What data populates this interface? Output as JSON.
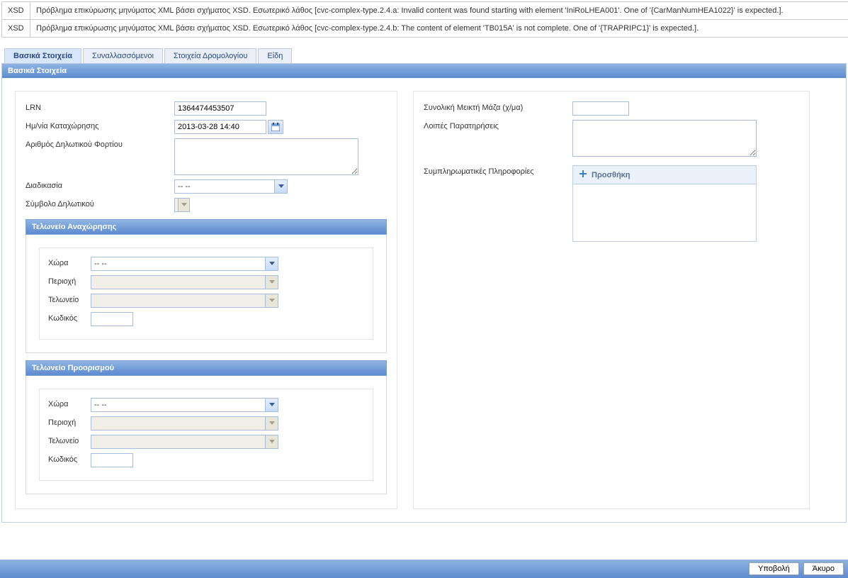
{
  "errors": [
    {
      "code": "XSD",
      "msg": "Πρόβλημα επικύρωσης μηνύματος XML βάσει σχήματος XSD. Εσωτερικό λάθος [cvc-complex-type.2.4.a: Invalid content was found starting with element 'IniRoLHEA001'. One of '{CarManNumHEA1022}' is expected.]."
    },
    {
      "code": "XSD",
      "msg": "Πρόβλημα επικύρωσης μηνύματος XML βάσει σχήματος XSD. Εσωτερικό λάθος [cvc-complex-type.2.4.b: The content of element 'TB015A' is not complete. One of '{TRAPRIPC1}' is expected.]."
    }
  ],
  "tabs": {
    "basic": "Βασικά Στοιχεία",
    "parties": "Συναλλασσόμενοι",
    "route": "Στοιχεία Δρομολογίου",
    "items": "Είδη"
  },
  "panel_title": "Βασικά Στοιχεία",
  "left": {
    "lrn_label": "LRN",
    "lrn_value": "1364474453507",
    "regdate_label": "Ημ/νία Καταχώρησης",
    "regdate_value": "2013-03-28 14:40",
    "cargo_label": "Αριθμός Δηλωτικού Φορτίου",
    "procedure_label": "Διαδικασία",
    "procedure_value": "-- --",
    "symbol_label": "Σύμβολο Δηλωτικού",
    "dep_title": "Τελωνείο Αναχώρησης",
    "dest_title": "Τελωνείο Προορισμού",
    "country_label": "Χώρα",
    "country_value": "-- --",
    "region_label": "Περιοχή",
    "customs_label": "Τελωνείο",
    "code_label": "Κωδικός"
  },
  "right": {
    "totalmass_label": "Συνολική Μεικτή Μάζα (χ/μα)",
    "remarks_label": "Λοιπές Παρατηρήσεις",
    "suppl_label": "Συμπληρωματικές Πληροφορίες",
    "add_label": "Προσθήκη"
  },
  "footer": {
    "submit": "Υποβολή",
    "cancel": "Άκυρο"
  }
}
